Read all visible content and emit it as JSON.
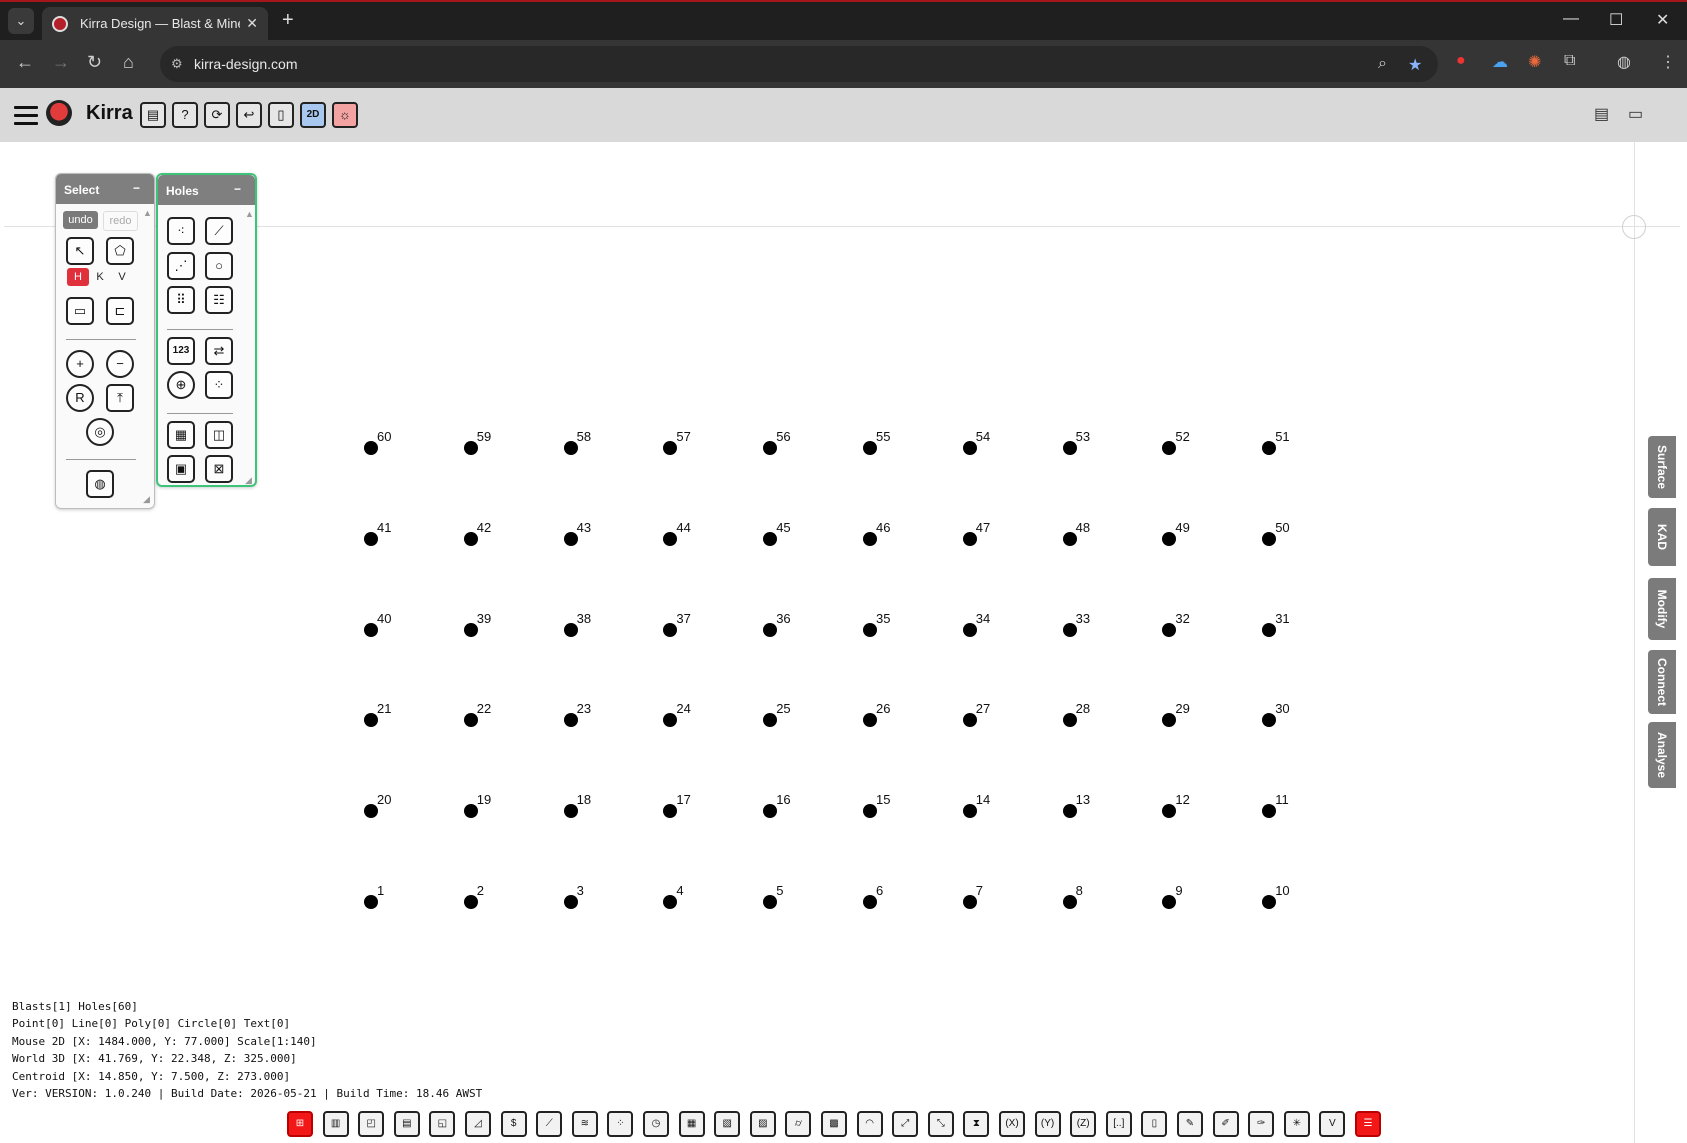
{
  "browser": {
    "tab_title": "Kirra Design — Blast & Mine Design",
    "url": "kirra-design.com",
    "window_controls": {
      "minimize": "—",
      "maximize": "☐",
      "close": "✕"
    }
  },
  "app": {
    "title": "Kirra",
    "header_icons": [
      "book-icon",
      "help-icon",
      "refresh-icon",
      "undo-arrow-icon",
      "layout-icon",
      "2d-icon",
      "sun-icon"
    ],
    "view_mode_label": "2D",
    "accent_2d": "#a8c8f0",
    "accent_sun": "#f4a3a3"
  },
  "select_panel": {
    "title": "Select",
    "minimize": "−",
    "undo_label": "undo",
    "redo_label": "redo",
    "hkv": [
      "H",
      "K",
      "V"
    ]
  },
  "holes_panel": {
    "title": "Holes",
    "minimize": "−",
    "number_tool_label": "123"
  },
  "side_tabs": [
    "Surface",
    "KAD",
    "Modify",
    "Connect",
    "Analyse"
  ],
  "holes": [
    {
      "id": "60",
      "col": 0,
      "row": 0
    },
    {
      "id": "59",
      "col": 1,
      "row": 0
    },
    {
      "id": "58",
      "col": 2,
      "row": 0
    },
    {
      "id": "57",
      "col": 3,
      "row": 0
    },
    {
      "id": "56",
      "col": 4,
      "row": 0
    },
    {
      "id": "55",
      "col": 5,
      "row": 0
    },
    {
      "id": "54",
      "col": 6,
      "row": 0
    },
    {
      "id": "53",
      "col": 7,
      "row": 0
    },
    {
      "id": "52",
      "col": 8,
      "row": 0
    },
    {
      "id": "51",
      "col": 9,
      "row": 0
    },
    {
      "id": "41",
      "col": 0,
      "row": 1
    },
    {
      "id": "42",
      "col": 1,
      "row": 1
    },
    {
      "id": "43",
      "col": 2,
      "row": 1
    },
    {
      "id": "44",
      "col": 3,
      "row": 1
    },
    {
      "id": "45",
      "col": 4,
      "row": 1
    },
    {
      "id": "46",
      "col": 5,
      "row": 1
    },
    {
      "id": "47",
      "col": 6,
      "row": 1
    },
    {
      "id": "48",
      "col": 7,
      "row": 1
    },
    {
      "id": "49",
      "col": 8,
      "row": 1
    },
    {
      "id": "50",
      "col": 9,
      "row": 1
    },
    {
      "id": "40",
      "col": 0,
      "row": 2
    },
    {
      "id": "39",
      "col": 1,
      "row": 2
    },
    {
      "id": "38",
      "col": 2,
      "row": 2
    },
    {
      "id": "37",
      "col": 3,
      "row": 2
    },
    {
      "id": "36",
      "col": 4,
      "row": 2
    },
    {
      "id": "35",
      "col": 5,
      "row": 2
    },
    {
      "id": "34",
      "col": 6,
      "row": 2
    },
    {
      "id": "33",
      "col": 7,
      "row": 2
    },
    {
      "id": "32",
      "col": 8,
      "row": 2
    },
    {
      "id": "31",
      "col": 9,
      "row": 2
    },
    {
      "id": "21",
      "col": 0,
      "row": 3
    },
    {
      "id": "22",
      "col": 1,
      "row": 3
    },
    {
      "id": "23",
      "col": 2,
      "row": 3
    },
    {
      "id": "24",
      "col": 3,
      "row": 3
    },
    {
      "id": "25",
      "col": 4,
      "row": 3
    },
    {
      "id": "26",
      "col": 5,
      "row": 3
    },
    {
      "id": "27",
      "col": 6,
      "row": 3
    },
    {
      "id": "28",
      "col": 7,
      "row": 3
    },
    {
      "id": "29",
      "col": 8,
      "row": 3
    },
    {
      "id": "30",
      "col": 9,
      "row": 3
    },
    {
      "id": "20",
      "col": 0,
      "row": 4
    },
    {
      "id": "19",
      "col": 1,
      "row": 4
    },
    {
      "id": "18",
      "col": 2,
      "row": 4
    },
    {
      "id": "17",
      "col": 3,
      "row": 4
    },
    {
      "id": "16",
      "col": 4,
      "row": 4
    },
    {
      "id": "15",
      "col": 5,
      "row": 4
    },
    {
      "id": "14",
      "col": 6,
      "row": 4
    },
    {
      "id": "13",
      "col": 7,
      "row": 4
    },
    {
      "id": "12",
      "col": 8,
      "row": 4
    },
    {
      "id": "11",
      "col": 9,
      "row": 4
    },
    {
      "id": "1",
      "col": 0,
      "row": 5
    },
    {
      "id": "2",
      "col": 1,
      "row": 5
    },
    {
      "id": "3",
      "col": 2,
      "row": 5
    },
    {
      "id": "4",
      "col": 3,
      "row": 5
    },
    {
      "id": "5",
      "col": 4,
      "row": 5
    },
    {
      "id": "6",
      "col": 5,
      "row": 5
    },
    {
      "id": "7",
      "col": 6,
      "row": 5
    },
    {
      "id": "8",
      "col": 7,
      "row": 5
    },
    {
      "id": "9",
      "col": 8,
      "row": 5
    },
    {
      "id": "10",
      "col": 9,
      "row": 5
    }
  ],
  "status": {
    "line1": "Blasts[1] Holes[60]",
    "line2": "Point[0] Line[0] Poly[0] Circle[0] Text[0]",
    "line3": "Mouse 2D [X: 1484.000, Y: 77.000] Scale[1:140]",
    "line4": "World 3D [X: 41.769, Y: 22.348, Z: 325.000]",
    "line5": "Centroid [X: 14.850, Y: 7.500, Z: 273.000]",
    "line6": "Ver: VERSION: 1.0.240 | Build Date: 2026-05-21 | Build Time: 18.46 AWST"
  },
  "bottom_toolbar": [
    {
      "icon": "hole-edit-icon",
      "glyph": "⊞",
      "red": true
    },
    {
      "icon": "hole-length-icon",
      "glyph": "▥"
    },
    {
      "icon": "hole-angle-icon",
      "glyph": "◰"
    },
    {
      "icon": "hole-diameter-icon",
      "glyph": "▤"
    },
    {
      "icon": "hole-subdrill-icon",
      "glyph": "◱"
    },
    {
      "icon": "hole-bearing-icon",
      "glyph": "◿"
    },
    {
      "icon": "hole-dollar-icon",
      "glyph": "$"
    },
    {
      "icon": "connect-line-icon",
      "glyph": "⟋"
    },
    {
      "icon": "path-icon",
      "glyph": "≋"
    },
    {
      "icon": "scatter-icon",
      "glyph": "⁘"
    },
    {
      "icon": "timing-icon",
      "glyph": "◷"
    },
    {
      "icon": "hole-type-icon",
      "glyph": "▦"
    },
    {
      "icon": "hole-id-icon",
      "glyph": "▧"
    },
    {
      "icon": "hole-label-icon",
      "glyph": "▨"
    },
    {
      "icon": "cylinder-icon",
      "glyph": "⌭"
    },
    {
      "icon": "charge-icon",
      "glyph": "▩"
    },
    {
      "icon": "arc-icon",
      "glyph": "◠"
    },
    {
      "icon": "vector-icon",
      "glyph": "⤢"
    },
    {
      "icon": "direction-icon",
      "glyph": "⤡"
    },
    {
      "icon": "delay-icon",
      "glyph": "⧗"
    },
    {
      "icon": "x-easting-icon",
      "glyph": "(X)"
    },
    {
      "icon": "y-northing-icon",
      "glyph": "(Y)"
    },
    {
      "icon": "z-elevation-icon",
      "glyph": "(Z)"
    },
    {
      "icon": "bracket-icon",
      "glyph": "[..]"
    },
    {
      "icon": "hole-burden-icon",
      "glyph": "▯"
    },
    {
      "icon": "draw-icon",
      "glyph": "✎"
    },
    {
      "icon": "pencil-icon",
      "glyph": "✐"
    },
    {
      "icon": "edit-hole-icon",
      "glyph": "✑"
    },
    {
      "icon": "star-icon",
      "glyph": "✳"
    },
    {
      "icon": "shield-v-icon",
      "glyph": "V"
    },
    {
      "icon": "list-icon",
      "glyph": "☰",
      "red": true
    }
  ]
}
